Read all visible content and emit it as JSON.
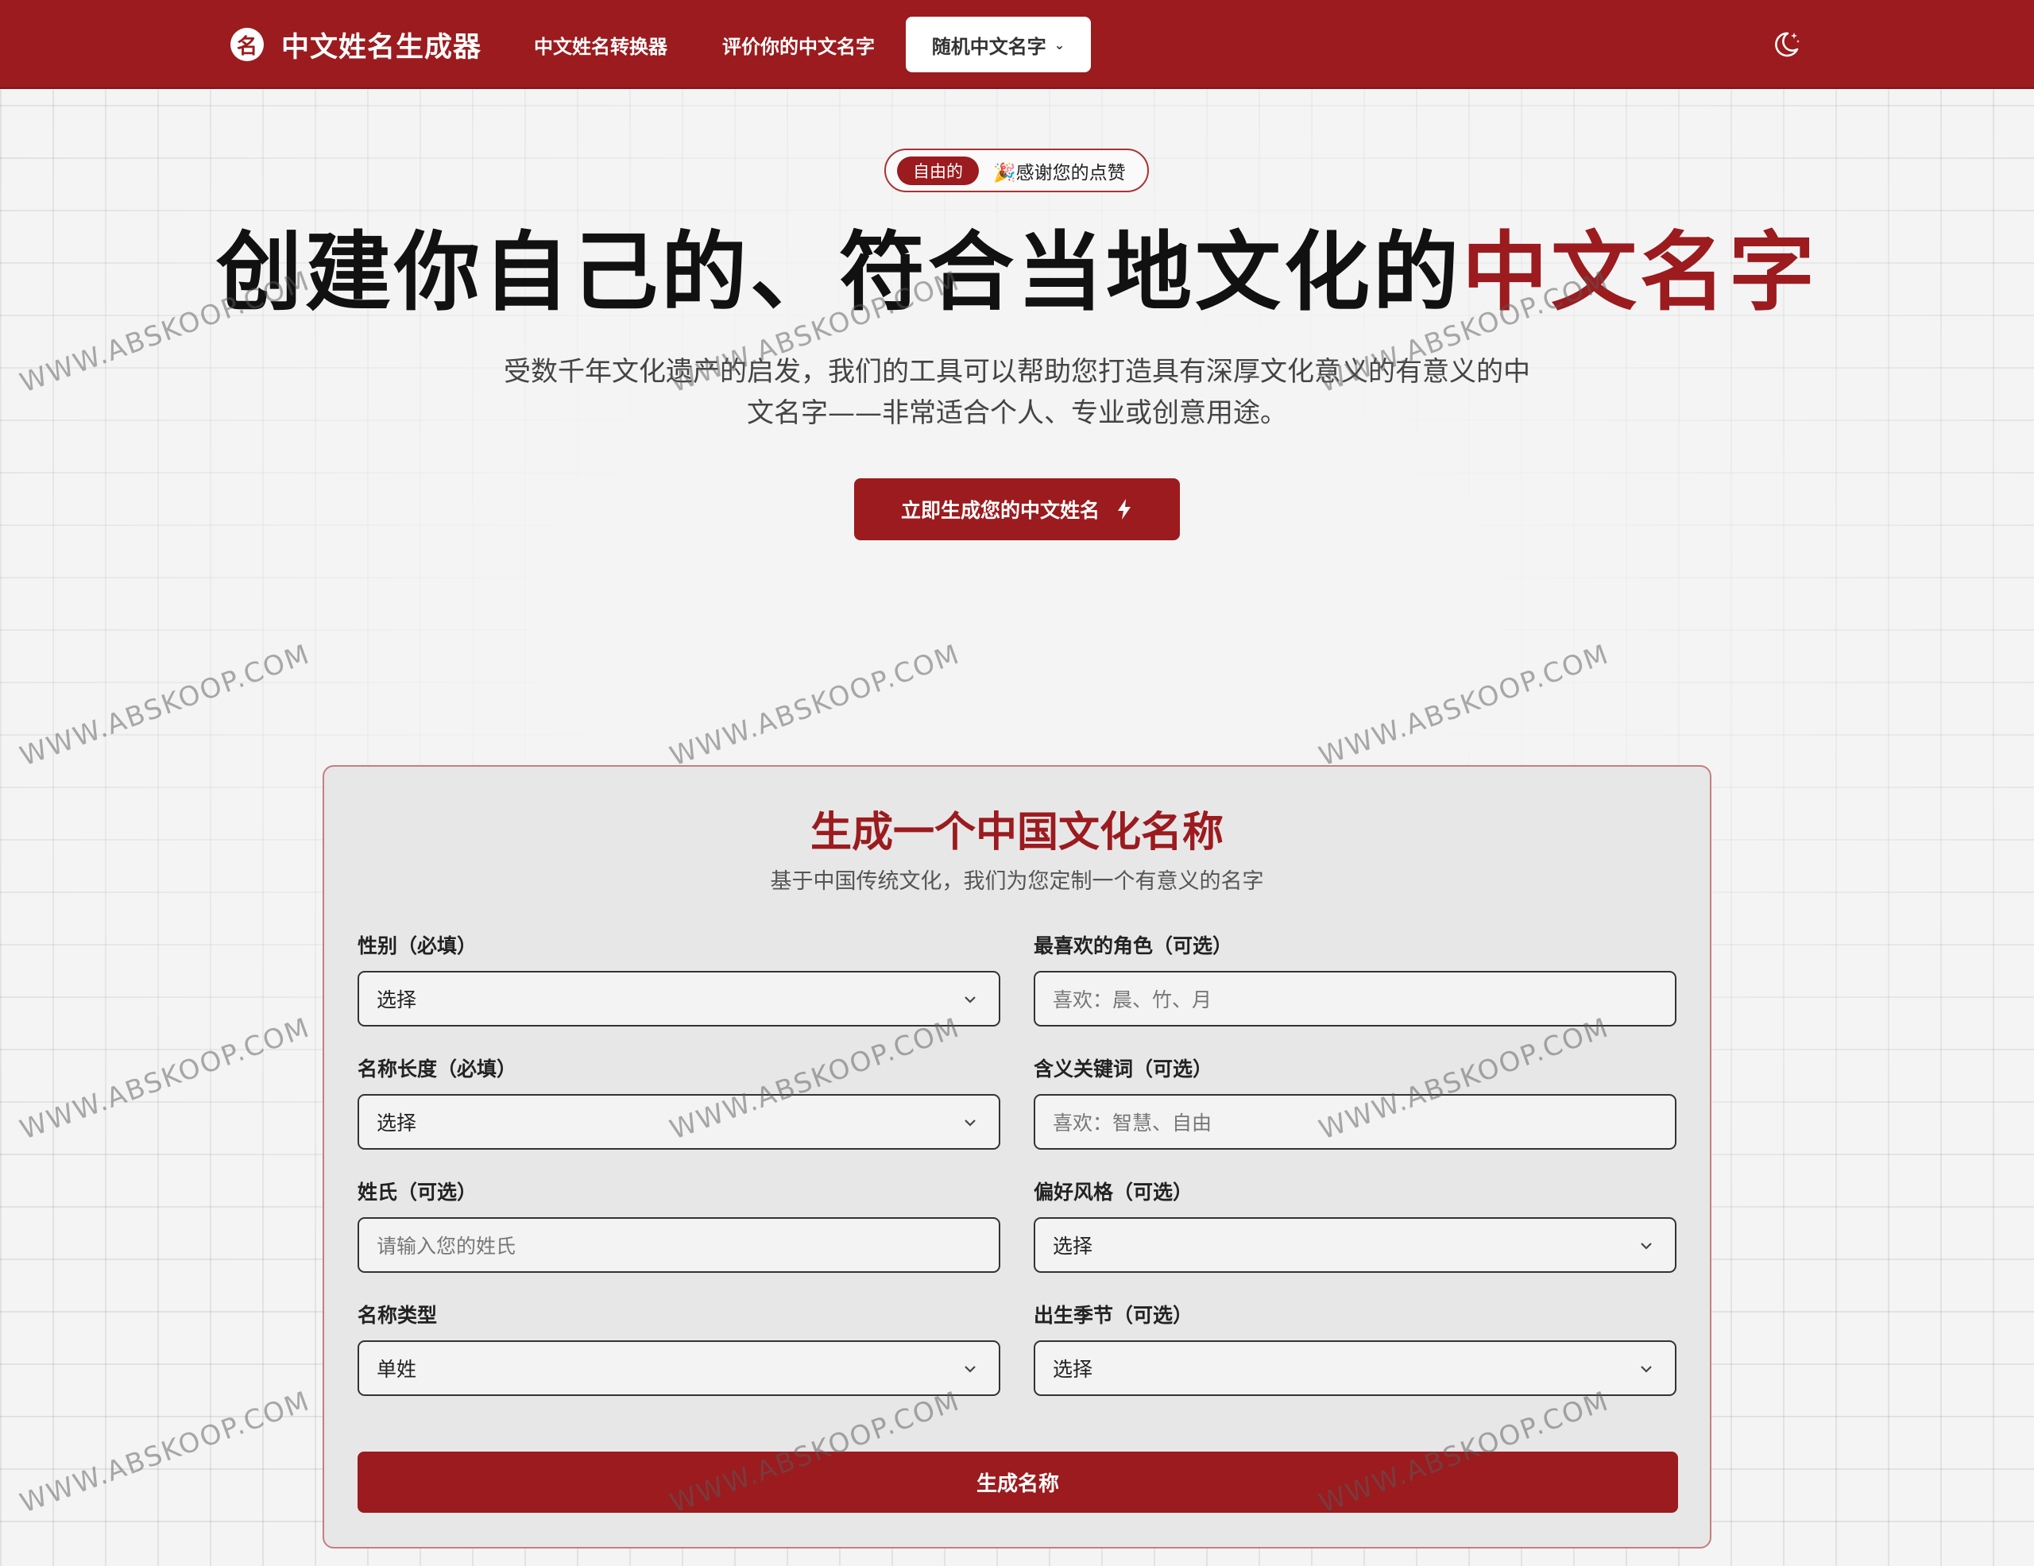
{
  "nav": {
    "logo_glyph": "名",
    "brand": "中文姓名生成器",
    "links": [
      "中文姓名转换器",
      "评价你的中文名字"
    ],
    "dropdown_label": "随机中文名字",
    "dropdown_caret": "⌄",
    "theme_icon": "moon-icon"
  },
  "hero": {
    "badge_pill": "自由的",
    "badge_text": "🎉感谢您的点赞",
    "title_main": "创建你自己的、符合当地文化的",
    "title_accent": "中文名字",
    "subtitle_line1": "受数千年文化遗产的启发，我们的工具可以帮助您打造具有深厚文化意义的有意义的中",
    "subtitle_line2": "文名字——非常适合个人、专业或创意用途。",
    "cta": "立即生成您的中文姓名",
    "cta_icon": "lightning-icon"
  },
  "form": {
    "title": "生成一个中国文化名称",
    "subtitle": "基于中国传统文化，我们为您定制一个有意义的名字",
    "gender_label": "性别（必填）",
    "gender_value": "选择",
    "character_label": "最喜欢的角色（可选）",
    "character_placeholder": "喜欢：晨、竹、月",
    "length_label": "名称长度（必填）",
    "length_value": "选择",
    "keywords_label": "含义关键词（可选）",
    "keywords_placeholder": "喜欢：智慧、自由",
    "surname_label": "姓氏（可选）",
    "surname_placeholder": "请输入您的姓氏",
    "style_label": "偏好风格（可选）",
    "style_value": "选择",
    "type_label": "名称类型",
    "type_value": "单姓",
    "season_label": "出生季节（可选）",
    "season_value": "选择",
    "submit": "生成名称"
  },
  "watermark": "WWW.ABSKOOP.COM",
  "colors": {
    "brand_red": "#9b1b1e",
    "background": "#f4f4f5",
    "card": "#e7e7e8"
  }
}
